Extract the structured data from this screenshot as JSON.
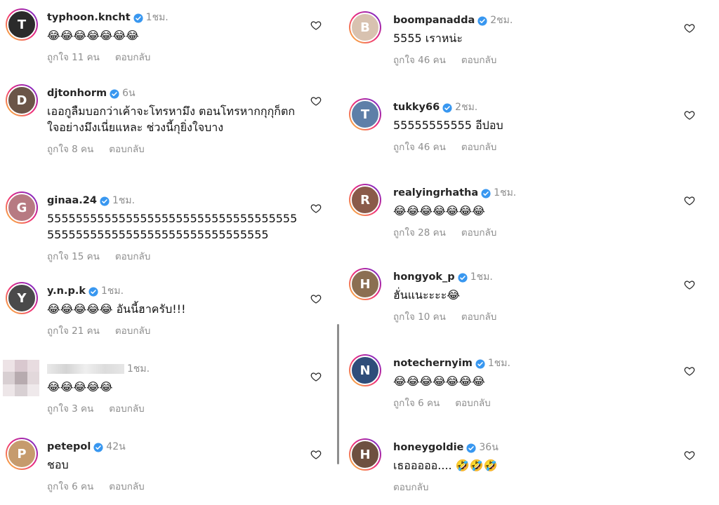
{
  "left_comments": [
    {
      "username": "typhoon.kncht",
      "time": "1ชม.",
      "text": "😂😂😂😂😂😂😂",
      "likes": "ถูกใจ 11 คน",
      "reply": "ตอบกลับ",
      "avatar_color": "#2b2b2b",
      "initial": "T"
    },
    {
      "username": "djtonhorm",
      "time": "6น",
      "text": "เออกูลืมบอกว่าเค้าจะโทรหามึง ตอนโทรหากกุกุก็ตกใจอย่างมึงเนี่ยแหละ ช่วงนี้กุยิ่งใจบาง",
      "likes": "ถูกใจ 8 คน",
      "reply": "ตอบกลับ",
      "avatar_color": "#6b5548",
      "initial": "D"
    },
    {
      "username": "ginaa.24",
      "time": "1ชม.",
      "text": "555555555555555555555555555555555555555555555555555555555555555555",
      "likes": "ถูกใจ 15 คน",
      "reply": "ตอบกลับ",
      "avatar_color": "#b77a82",
      "initial": "G"
    },
    {
      "username": "y.n.p.k",
      "time": "1ชม.",
      "text": "😂😂😂😂😂 อันนี้ฮาครับ!!!",
      "likes": "ถูกใจ 21 คน",
      "reply": "ตอบกลับ",
      "avatar_color": "#4a4a4a",
      "initial": "Y"
    },
    {
      "username": "",
      "time": "1ชม.",
      "text": "😂😂😂😂😂",
      "likes": "ถูกใจ 3 คน",
      "reply": "ตอบกลับ",
      "avatar_color": "#cccccc",
      "initial": ""
    },
    {
      "username": "petepol",
      "time": "42น",
      "text": "ชอบ",
      "likes": "ถูกใจ 6 คน",
      "reply": "ตอบกลับ",
      "avatar_color": "#c69b6d",
      "initial": "P"
    }
  ],
  "right_comments": [
    {
      "username": "boompanadda",
      "time": "2ชม.",
      "text": "5555 เราหน่ะ",
      "likes": "ถูกใจ 46 คน",
      "reply": "ตอบกลับ",
      "avatar_color": "#d8c2b0",
      "initial": "B"
    },
    {
      "username": "tukky66",
      "time": "2ชม.",
      "text": "55555555555 อีปอบ",
      "likes": "ถูกใจ 46 คน",
      "reply": "ตอบกลับ",
      "avatar_color": "#5e7fa8",
      "initial": "T"
    },
    {
      "username": "realyingrhatha",
      "time": "1ชม.",
      "text": "😂😂😂😂😂😂😂",
      "likes": "ถูกใจ 28 คน",
      "reply": "ตอบกลับ",
      "avatar_color": "#8a5a4a",
      "initial": "R"
    },
    {
      "username": "hongyok_p",
      "time": "1ชม.",
      "text": "ฮั่นแนะะะะ😂",
      "likes": "ถูกใจ 10 คน",
      "reply": "ตอบกลับ",
      "avatar_color": "#8b6f52",
      "initial": "H"
    },
    {
      "username": "notechernyim",
      "time": "1ชม.",
      "text": "😂😂😂😂😂😂😂",
      "likes": "ถูกใจ 6 คน",
      "reply": "ตอบกลับ",
      "avatar_color": "#2f4d7a",
      "initial": "N"
    },
    {
      "username": "honeygoldie",
      "time": "36น",
      "text": "เธอออออ.... 🤣🤣🤣",
      "likes": "",
      "reply": "ตอบกลับ",
      "avatar_color": "#6e5040",
      "initial": "H"
    }
  ],
  "icons": {
    "verified": "verified-badge-icon",
    "heart": "heart-outline-icon"
  }
}
